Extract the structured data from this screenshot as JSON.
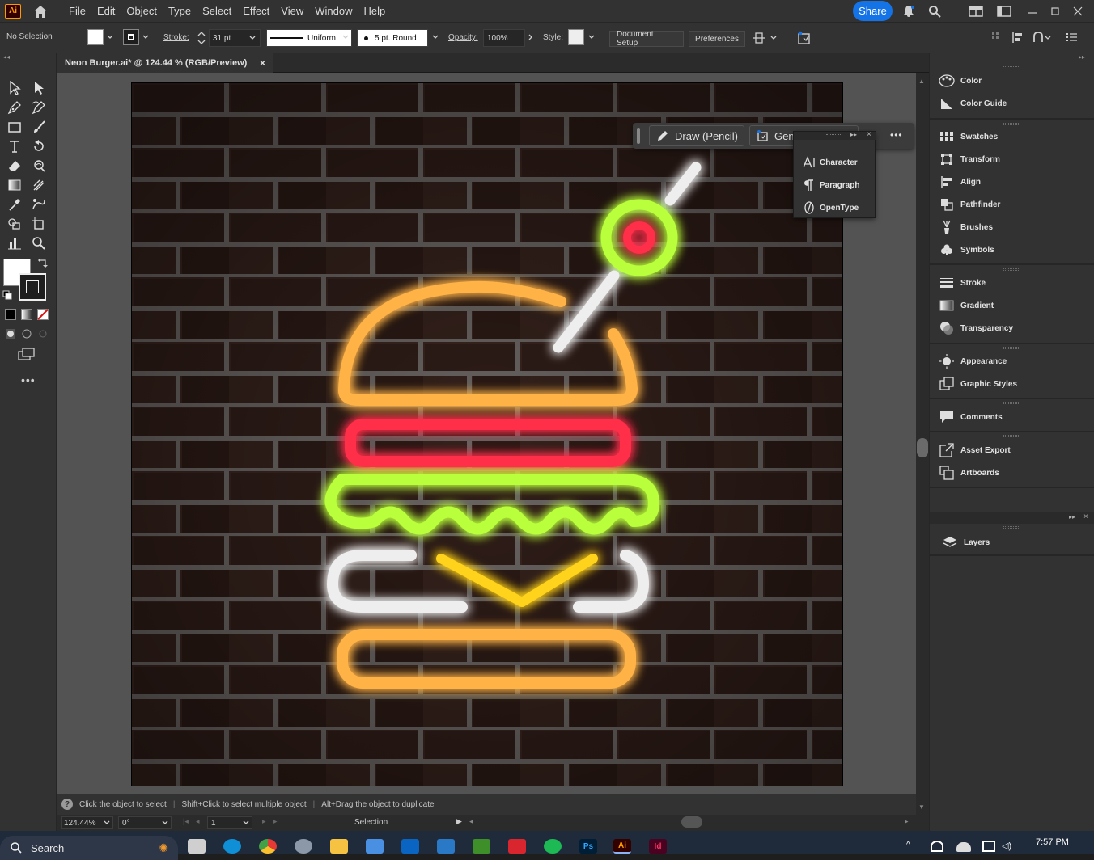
{
  "menu": {
    "items": [
      "File",
      "Edit",
      "Object",
      "Type",
      "Select",
      "Effect",
      "View",
      "Window",
      "Help"
    ],
    "share_label": "Share",
    "app_logo": "Ai"
  },
  "controlbar": {
    "selection_label": "No Selection",
    "stroke_label": "Stroke:",
    "stroke_value": "31 pt",
    "uniform_label": "Uniform",
    "brush_label": "5 pt. Round",
    "opacity_label": "Opacity:",
    "opacity_value": "100%",
    "style_label": "Style:",
    "document_setup": "Document Setup",
    "preferences": "Preferences"
  },
  "document": {
    "tab_title": "Neon Burger.ai* @ 124.44 % (RGB/Preview)",
    "close_glyph": "×"
  },
  "context_bar": {
    "pencil_label": "Draw (Pencil)",
    "gen_label": "Gene",
    "more_glyph": "•••"
  },
  "type_popup": {
    "items": [
      {
        "label": "Character",
        "icon": "character-icon"
      },
      {
        "label": "Paragraph",
        "icon": "paragraph-icon"
      },
      {
        "label": "OpenType",
        "icon": "opentype-icon"
      }
    ]
  },
  "right_panels": {
    "groups": [
      [
        "Color",
        "Color Guide"
      ],
      [
        "Swatches",
        "Transform",
        "Align",
        "Pathfinder",
        "Brushes",
        "Symbols"
      ],
      [
        "Stroke",
        "Gradient",
        "Transparency"
      ],
      [
        "Appearance",
        "Graphic Styles"
      ],
      [
        "Comments"
      ],
      [
        "Asset Export",
        "Artboards"
      ]
    ],
    "layers": "Layers"
  },
  "hints": {
    "hint1": "Click the object to select",
    "hint2": "Shift+Click to select multiple object",
    "hint3": "Alt+Drag the object to duplicate"
  },
  "status": {
    "zoom": "124.44%",
    "rotation": "0°",
    "artboard": "1",
    "tool": "Selection"
  },
  "taskbar": {
    "search_label": "Search",
    "time": "7:57 PM",
    "apps": [
      "Ps",
      "Ai",
      "Id"
    ]
  },
  "colors": {
    "accent": "#1473e6",
    "neon_orange": "#ffb347",
    "neon_red": "#ff2d4a",
    "neon_green": "#b9ff3a",
    "neon_white": "#eeeeee",
    "neon_yellow": "#ffd21a"
  }
}
